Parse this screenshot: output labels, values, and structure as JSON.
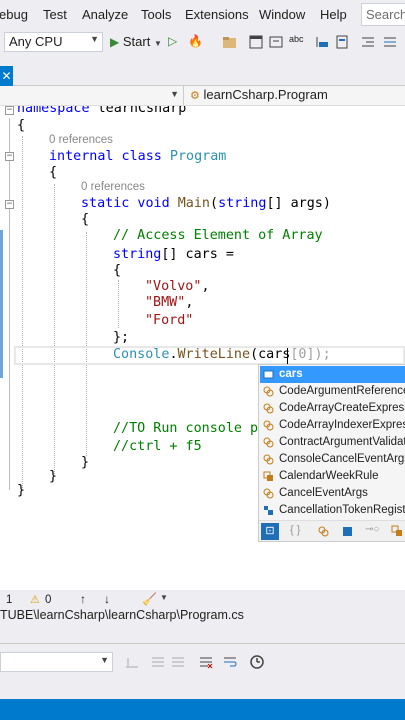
{
  "menu": {
    "items": [
      "ebug",
      "Test",
      "Analyze",
      "Tools",
      "Extensions",
      "Window",
      "Help"
    ],
    "search_placeholder": "Search"
  },
  "toolbar": {
    "platform": "Any CPU",
    "start_label": "Start"
  },
  "tab": {
    "close_glyph": "✕"
  },
  "navbar": {
    "member": "learnCsharp.Program"
  },
  "code": {
    "ref1": "0 references",
    "ref2": "0 references",
    "lines": {
      "l1_kw": "namespace",
      "l1_name": " learnCsharp",
      "l2": "{",
      "l3_kw1": "internal",
      "l3_kw2": " class",
      "l3_type": " Program",
      "l4": "{",
      "l5_kw1": "static",
      "l5_kw2": " void",
      "l5_method": " Main",
      "l5_rest_a": "(",
      "l5_kw3": "string",
      "l5_rest_b": "[] args)",
      "l6": "{",
      "l7_comment": "// Access Element of Array",
      "l8_kw": "string",
      "l8_rest": "[] cars =",
      "l9": "{",
      "l10_str": "\"Volvo\"",
      "l10_punct": ",",
      "l11_str": "\"BMW\"",
      "l11_punct": ",",
      "l12_str": "\"Ford\"",
      "l13": "};",
      "l14_type": "Console",
      "l14_dot": ".",
      "l14_method": "WriteLine",
      "l14_typed": "(cars",
      "l14_ghost": "[0]);",
      "l15_comment": "//TO Run console p",
      "l16_comment": "//ctrl + f5",
      "l17": "}",
      "l18": "}",
      "l19": "}"
    }
  },
  "completion": {
    "items": [
      {
        "label": "cars",
        "kind": "local",
        "selected": true
      },
      {
        "label": "CodeArgumentReferenceEx",
        "kind": "class"
      },
      {
        "label": "CodeArrayCreateExpression",
        "kind": "class"
      },
      {
        "label": "CodeArrayIndexerExpressio",
        "kind": "class"
      },
      {
        "label": "ContractArgumentValidato",
        "kind": "class"
      },
      {
        "label": "ConsoleCancelEventArgs",
        "kind": "class"
      },
      {
        "label": "CalendarWeekRule",
        "kind": "enum"
      },
      {
        "label": "CancelEventArgs",
        "kind": "class"
      },
      {
        "label": "CancellationTokenRegistrat",
        "kind": "struct"
      }
    ],
    "filter_braces": "{ }"
  },
  "errors": {
    "error_count": "1",
    "warning_count": "0"
  },
  "path": {
    "text": "TUBE\\learnCsharp\\learnCsharp\\Program.cs"
  },
  "colors": {
    "accent": "#007acc",
    "keyword": "#0000ff",
    "type": "#2b91af",
    "string": "#a31515",
    "comment": "#008000"
  }
}
